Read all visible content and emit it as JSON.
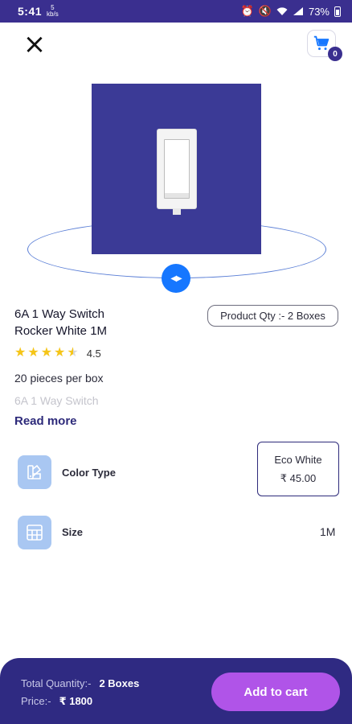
{
  "status_bar": {
    "time": "5:41",
    "network_top": "5",
    "network_bottom": "kb/s",
    "battery": "73%"
  },
  "header": {
    "close_icon": "close-icon",
    "cart_icon": "cart-icon",
    "cart_count": "0"
  },
  "product": {
    "title_line1": "6A 1 Way Switch",
    "title_line2": "Rocker White 1M",
    "qty_pill": "Product Qty :- 2 Boxes",
    "rating_value": "4.5",
    "pieces": "20 pieces per box",
    "description_preview": "6A 1 Way Switch",
    "read_more": "Read more",
    "image_bg_color": "#3b3a96"
  },
  "options": {
    "color": {
      "label": "Color Type",
      "selected_name": "Eco White",
      "selected_price": "₹ 45.00",
      "icon": "palette-icon"
    },
    "size": {
      "label": "Size",
      "value": "1M",
      "icon": "grid-icon"
    }
  },
  "bottom_bar": {
    "total_qty_label": "Total Quantity:-",
    "total_qty_value": "2 Boxes",
    "price_label": "Price:-",
    "price_value": "₹ 1800",
    "add_to_cart": "Add to cart",
    "bar_color": "#2f2a82",
    "button_color": "#b054e8"
  },
  "accent_color": "#1677ff"
}
